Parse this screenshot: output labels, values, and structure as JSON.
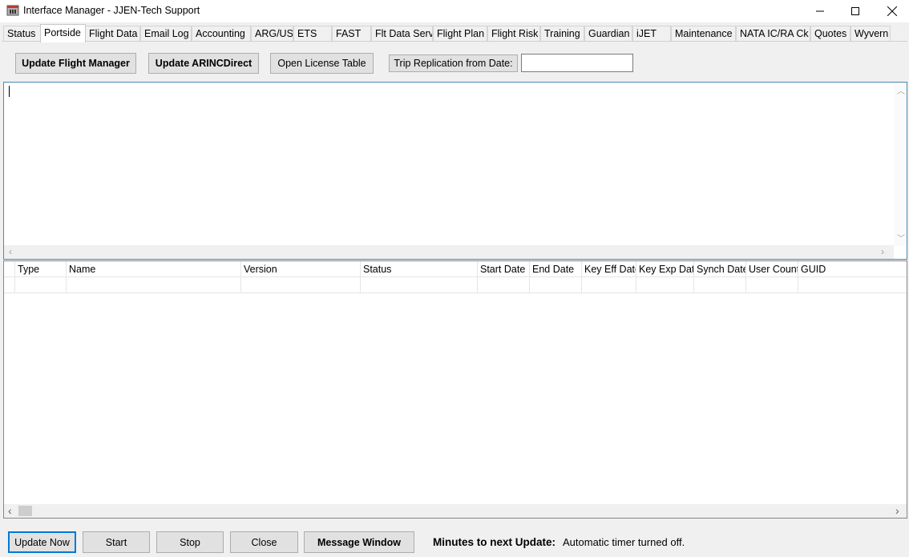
{
  "window": {
    "title": "Interface Manager - JJEN-Tech Support",
    "minimize_icon": "minimize-icon",
    "maximize_icon": "maximize-icon",
    "close_icon": "close-icon"
  },
  "tabs": [
    {
      "label": "Status"
    },
    {
      "label": "Portside",
      "active": true
    },
    {
      "label": "Flight Data"
    },
    {
      "label": "Email Log"
    },
    {
      "label": "Accounting"
    },
    {
      "label": "ARG/US"
    },
    {
      "label": "ETS"
    },
    {
      "label": "FAST"
    },
    {
      "label": "Flt Data Serv"
    },
    {
      "label": "Flight Plan"
    },
    {
      "label": "Flight Risk"
    },
    {
      "label": "Training"
    },
    {
      "label": "Guardian"
    },
    {
      "label": "iJET"
    },
    {
      "label": "Maintenance"
    },
    {
      "label": "NATA IC/RA Ck"
    },
    {
      "label": "Quotes"
    },
    {
      "label": "Wyvern"
    }
  ],
  "toolbar": {
    "update_flight_manager": "Update Flight Manager",
    "update_arincdirect": "Update ARINCDirect",
    "open_license_table": "Open License Table",
    "trip_replication": "Trip Replication from Date:",
    "trip_date_value": ""
  },
  "log": {
    "text": ""
  },
  "grid": {
    "columns": [
      "Type",
      "Name",
      "Version",
      "Status",
      "Start Date",
      "End Date",
      "Key Eff Date",
      "Key Exp Date",
      "Synch Date",
      "User Count",
      "GUID"
    ],
    "rows": [
      [
        "",
        "",
        "",
        "",
        "",
        "",
        "",
        "",
        "",
        "",
        ""
      ]
    ]
  },
  "footer": {
    "update_now": "Update Now",
    "start": "Start",
    "stop": "Stop",
    "close": "Close",
    "message_window": "Message Window",
    "minutes_label": "Minutes to next Update:",
    "timer_status": "Automatic timer turned off."
  },
  "colors": {
    "focus_border": "#0078d7",
    "log_border": "#4a8ab3"
  }
}
